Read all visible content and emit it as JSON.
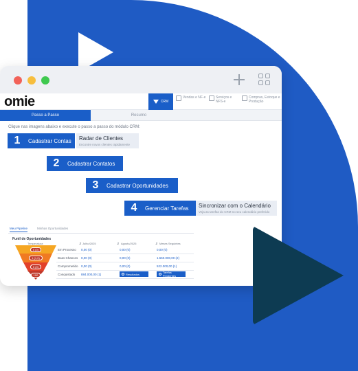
{
  "window": {
    "logo": "omie"
  },
  "nav": {
    "crm": "CRM",
    "vendas": "Vendas e NF-e",
    "servicos": "Serviços e NFS-e",
    "compras": "Compras, Estoque e Produção"
  },
  "tabs": {
    "passo": "Passo a Passo",
    "resumo": "Resumo"
  },
  "instruction": "Clique nas imagens abaixo e execute o passo a passo do módulo CRM:",
  "steps": [
    {
      "num": "1",
      "label": "Cadastrar Contas",
      "callout_title": "Radar de Clientes",
      "callout_sub": "Encontre novos clientes rapidamente"
    },
    {
      "num": "2",
      "label": "Cadastrar Contatos"
    },
    {
      "num": "3",
      "label": "Cadastrar Oportunidades"
    },
    {
      "num": "4",
      "label": "Gerenciar Tarefas",
      "callout_title": "Sincronizar com o Calendário",
      "callout_sub": "Veja as tarefas do CRM no seu calendário preferido"
    }
  ],
  "subtabs": {
    "meu_pipeline": "Meu Pipeline",
    "minhas_oportunidades": "Minhas Oportunidades"
  },
  "funnel": {
    "title": "Funil de Oportunidades",
    "headers": {
      "temp": "Temperatura",
      "julho": "Julho/2025",
      "agosto": "Agosto/2025",
      "mais": "Meses Seguintes"
    },
    "sort_a": "⇵",
    "sort_b": "⇵",
    "sort_c": "⇵",
    "badges": [
      "0 (0)",
      "1 (1,0)",
      "0 (0)",
      "100"
    ],
    "rows": [
      {
        "stage": "Em Processo",
        "julho": "0,00 (0)",
        "agosto": "0,00 (0)",
        "mais": "0,00 (0)"
      },
      {
        "stage": "Boas Chances",
        "julho": "0,00 (0)",
        "agosto": "0,00 (0)",
        "mais": "1.550.000,00 (2)"
      },
      {
        "stage": "Comprometido",
        "julho": "0,00 (0)",
        "agosto": "0,00 (0)",
        "mais": "522.000,00 (1)"
      },
      {
        "stage": "Conquistado",
        "julho": "884.000,00 (1)",
        "agosto_btn": "Resultados",
        "mais_btn": "Tarefas Pendentes"
      }
    ]
  },
  "colors": {
    "brand_blue": "#1a5ec8",
    "background_blue": "#1f5bc4",
    "dark_play": "#0d3b52"
  }
}
